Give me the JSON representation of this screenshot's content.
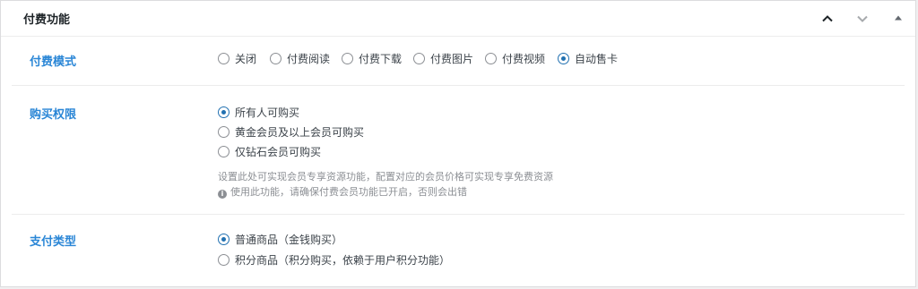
{
  "panel": {
    "title": "付费功能"
  },
  "header_icons": [
    "chevron-up-icon",
    "chevron-down-icon",
    "triangle-up-icon"
  ],
  "pay_mode": {
    "label": "付费模式",
    "options": [
      "关闭",
      "付费阅读",
      "付费下载",
      "付费图片",
      "付费视频",
      "自动售卡"
    ],
    "selected": "自动售卡"
  },
  "purchase_permission": {
    "label": "购买权限",
    "options": [
      "所有人可购买",
      "黄金会员及以上会员可购买",
      "仅钻石会员可购买"
    ],
    "selected": "所有人可购买",
    "description": "设置此处可实现会员专享资源功能，配置对应的会员价格可实现专享免费资源",
    "notice": "使用此功能，请确保付费会员功能已开启，否则会出错"
  },
  "pay_type": {
    "label": "支付类型",
    "options": [
      "普通商品（金钱购买）",
      "积分商品（积分购买，依赖于用户积分功能）"
    ],
    "selected": "普通商品（金钱购买）"
  },
  "colors": {
    "label_blue": "#2a86d6",
    "radio_blue": "#2271b1",
    "muted": "#8c8f94"
  }
}
